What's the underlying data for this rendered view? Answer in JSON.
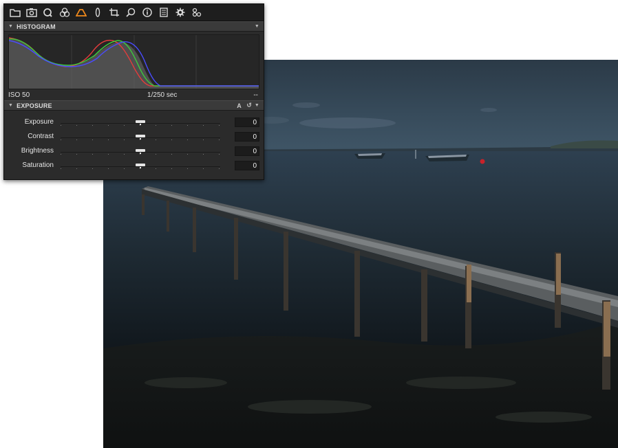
{
  "toolbar": {
    "tools": [
      {
        "icon": "folder-icon"
      },
      {
        "icon": "camera-icon"
      },
      {
        "icon": "loupe-icon"
      },
      {
        "icon": "color-circles-icon"
      },
      {
        "icon": "exposure-icon",
        "active": true
      },
      {
        "icon": "lens-icon"
      },
      {
        "icon": "crop-icon"
      },
      {
        "icon": "local-adjustment-icon"
      },
      {
        "icon": "info-icon"
      },
      {
        "icon": "metadata-icon"
      },
      {
        "icon": "settings-gear-icon"
      },
      {
        "icon": "batch-icon"
      }
    ],
    "active_color": "#f08a1c"
  },
  "histogram": {
    "title": "HISTOGRAM",
    "iso": "ISO 50",
    "shutter": "1/250 sec",
    "aperture": "--"
  },
  "exposure": {
    "title": "EXPOSURE",
    "auto_label": "A",
    "sliders": [
      {
        "label": "Exposure",
        "value": "0"
      },
      {
        "label": "Contrast",
        "value": "0"
      },
      {
        "label": "Brightness",
        "value": "0"
      },
      {
        "label": "Saturation",
        "value": "0"
      }
    ]
  }
}
